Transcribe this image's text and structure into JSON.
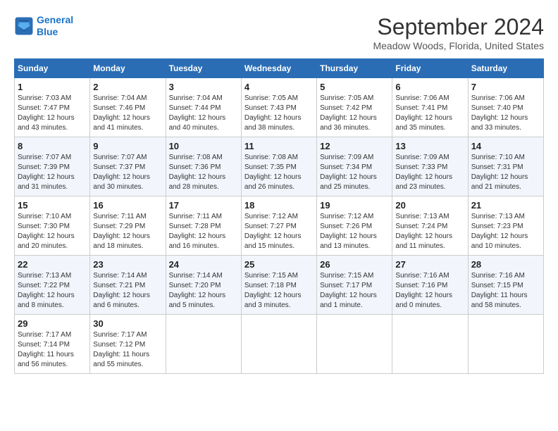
{
  "header": {
    "logo_line1": "General",
    "logo_line2": "Blue",
    "month_title": "September 2024",
    "location": "Meadow Woods, Florida, United States"
  },
  "weekdays": [
    "Sunday",
    "Monday",
    "Tuesday",
    "Wednesday",
    "Thursday",
    "Friday",
    "Saturday"
  ],
  "weeks": [
    [
      {
        "day": "1",
        "sunrise": "7:03 AM",
        "sunset": "7:47 PM",
        "daylight": "12 hours and 43 minutes."
      },
      {
        "day": "2",
        "sunrise": "7:04 AM",
        "sunset": "7:46 PM",
        "daylight": "12 hours and 41 minutes."
      },
      {
        "day": "3",
        "sunrise": "7:04 AM",
        "sunset": "7:44 PM",
        "daylight": "12 hours and 40 minutes."
      },
      {
        "day": "4",
        "sunrise": "7:05 AM",
        "sunset": "7:43 PM",
        "daylight": "12 hours and 38 minutes."
      },
      {
        "day": "5",
        "sunrise": "7:05 AM",
        "sunset": "7:42 PM",
        "daylight": "12 hours and 36 minutes."
      },
      {
        "day": "6",
        "sunrise": "7:06 AM",
        "sunset": "7:41 PM",
        "daylight": "12 hours and 35 minutes."
      },
      {
        "day": "7",
        "sunrise": "7:06 AM",
        "sunset": "7:40 PM",
        "daylight": "12 hours and 33 minutes."
      }
    ],
    [
      {
        "day": "8",
        "sunrise": "7:07 AM",
        "sunset": "7:39 PM",
        "daylight": "12 hours and 31 minutes."
      },
      {
        "day": "9",
        "sunrise": "7:07 AM",
        "sunset": "7:37 PM",
        "daylight": "12 hours and 30 minutes."
      },
      {
        "day": "10",
        "sunrise": "7:08 AM",
        "sunset": "7:36 PM",
        "daylight": "12 hours and 28 minutes."
      },
      {
        "day": "11",
        "sunrise": "7:08 AM",
        "sunset": "7:35 PM",
        "daylight": "12 hours and 26 minutes."
      },
      {
        "day": "12",
        "sunrise": "7:09 AM",
        "sunset": "7:34 PM",
        "daylight": "12 hours and 25 minutes."
      },
      {
        "day": "13",
        "sunrise": "7:09 AM",
        "sunset": "7:33 PM",
        "daylight": "12 hours and 23 minutes."
      },
      {
        "day": "14",
        "sunrise": "7:10 AM",
        "sunset": "7:31 PM",
        "daylight": "12 hours and 21 minutes."
      }
    ],
    [
      {
        "day": "15",
        "sunrise": "7:10 AM",
        "sunset": "7:30 PM",
        "daylight": "12 hours and 20 minutes."
      },
      {
        "day": "16",
        "sunrise": "7:11 AM",
        "sunset": "7:29 PM",
        "daylight": "12 hours and 18 minutes."
      },
      {
        "day": "17",
        "sunrise": "7:11 AM",
        "sunset": "7:28 PM",
        "daylight": "12 hours and 16 minutes."
      },
      {
        "day": "18",
        "sunrise": "7:12 AM",
        "sunset": "7:27 PM",
        "daylight": "12 hours and 15 minutes."
      },
      {
        "day": "19",
        "sunrise": "7:12 AM",
        "sunset": "7:26 PM",
        "daylight": "12 hours and 13 minutes."
      },
      {
        "day": "20",
        "sunrise": "7:13 AM",
        "sunset": "7:24 PM",
        "daylight": "12 hours and 11 minutes."
      },
      {
        "day": "21",
        "sunrise": "7:13 AM",
        "sunset": "7:23 PM",
        "daylight": "12 hours and 10 minutes."
      }
    ],
    [
      {
        "day": "22",
        "sunrise": "7:13 AM",
        "sunset": "7:22 PM",
        "daylight": "12 hours and 8 minutes."
      },
      {
        "day": "23",
        "sunrise": "7:14 AM",
        "sunset": "7:21 PM",
        "daylight": "12 hours and 6 minutes."
      },
      {
        "day": "24",
        "sunrise": "7:14 AM",
        "sunset": "7:20 PM",
        "daylight": "12 hours and 5 minutes."
      },
      {
        "day": "25",
        "sunrise": "7:15 AM",
        "sunset": "7:18 PM",
        "daylight": "12 hours and 3 minutes."
      },
      {
        "day": "26",
        "sunrise": "7:15 AM",
        "sunset": "7:17 PM",
        "daylight": "12 hours and 1 minute."
      },
      {
        "day": "27",
        "sunrise": "7:16 AM",
        "sunset": "7:16 PM",
        "daylight": "12 hours and 0 minutes."
      },
      {
        "day": "28",
        "sunrise": "7:16 AM",
        "sunset": "7:15 PM",
        "daylight": "11 hours and 58 minutes."
      }
    ],
    [
      {
        "day": "29",
        "sunrise": "7:17 AM",
        "sunset": "7:14 PM",
        "daylight": "11 hours and 56 minutes."
      },
      {
        "day": "30",
        "sunrise": "7:17 AM",
        "sunset": "7:12 PM",
        "daylight": "11 hours and 55 minutes."
      },
      null,
      null,
      null,
      null,
      null
    ]
  ]
}
